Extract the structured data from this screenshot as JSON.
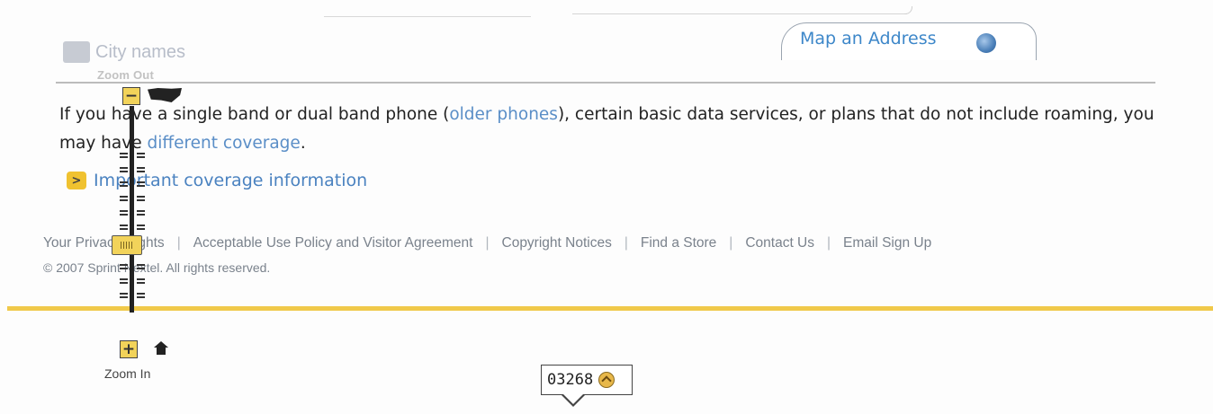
{
  "layers": {
    "city_names_label": "City names"
  },
  "zoom": {
    "out_label": "Zoom Out",
    "in_label": "Zoom In",
    "out_symbol": "−",
    "in_symbol": "+",
    "level_fraction": 0.6,
    "home_icon": "home-icon",
    "us_map_icon": "usa-map-icon"
  },
  "tabs": {
    "map_address_label": "Map an Address",
    "map_address_icon": "globe-icon"
  },
  "content": {
    "para_part1": "If you have a single band or dual band phone (",
    "older_phones_link": "older phones",
    "para_part2": "), certain basic data services, or plans that do not include roaming, you may have ",
    "different_coverage_link": "different coverage",
    "para_end": ".",
    "important_arrow_symbol": ">",
    "important_link": "Important coverage information"
  },
  "footer": {
    "links": [
      "Your Privacy Rights",
      "Acceptable Use Policy and Visitor Agreement",
      "Copyright Notices",
      "Find a Store",
      "Contact Us",
      "Email Sign Up"
    ],
    "copyright": "© 2007 Sprint Nextel. All rights reserved."
  },
  "zip_callout": {
    "value": "03268"
  },
  "colors": {
    "link": "#5a8ec7",
    "accent_yellow": "#f0c94a",
    "text": "#222222"
  }
}
